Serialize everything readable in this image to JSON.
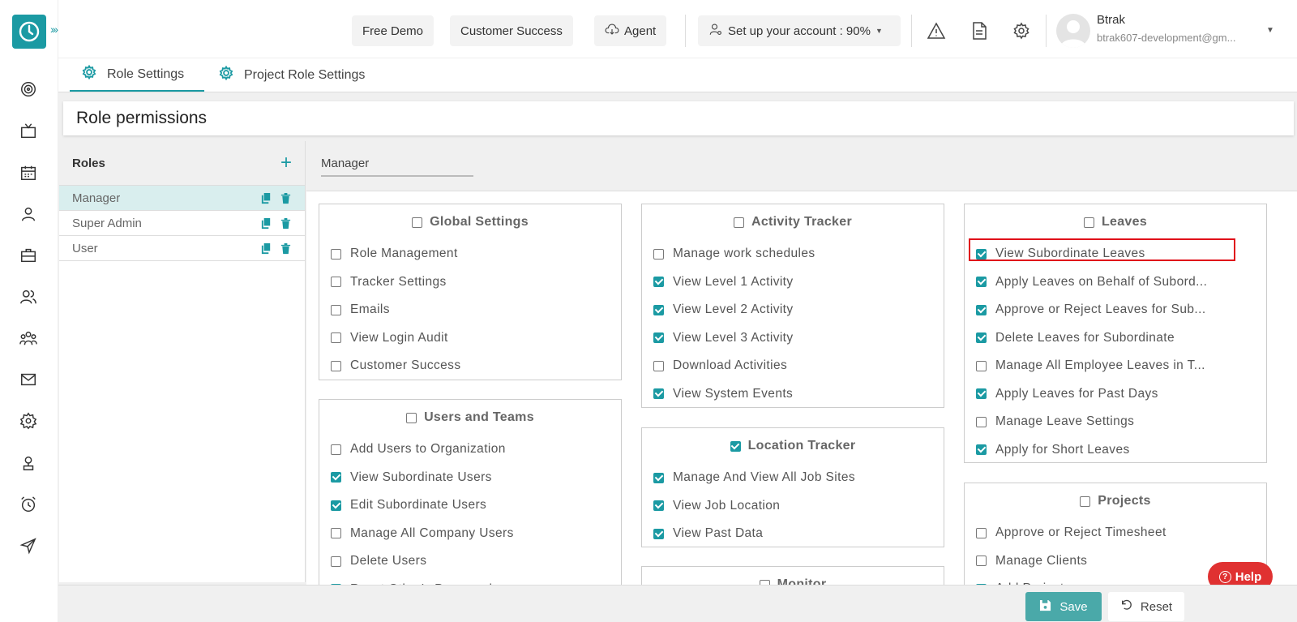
{
  "topbar": {
    "free_demo": "Free Demo",
    "customer_success": "Customer Success",
    "agent": "Agent",
    "setup_account": "Set up your account : 90%",
    "user_name": "Btrak",
    "user_email": "btrak607-development@gm..."
  },
  "tabs": [
    {
      "label": "Role Settings",
      "active": true
    },
    {
      "label": "Project Role Settings",
      "active": false
    }
  ],
  "page_title": "Role permissions",
  "roles": {
    "title": "Roles",
    "items": [
      {
        "name": "Manager",
        "selected": true
      },
      {
        "name": "Super Admin",
        "selected": false
      },
      {
        "name": "User",
        "selected": false
      }
    ]
  },
  "selected_role": "Manager",
  "permission_groups": {
    "global_settings": {
      "title": "Global Settings",
      "checked": false,
      "items": [
        {
          "label": "Role Management",
          "checked": false
        },
        {
          "label": "Tracker Settings",
          "checked": false
        },
        {
          "label": "Emails",
          "checked": false
        },
        {
          "label": "View Login Audit",
          "checked": false
        },
        {
          "label": "Customer Success",
          "checked": false
        }
      ]
    },
    "users_and_teams": {
      "title": "Users and Teams",
      "checked": false,
      "items": [
        {
          "label": "Add Users to Organization",
          "checked": false
        },
        {
          "label": "View Subordinate Users",
          "checked": true
        },
        {
          "label": "Edit Subordinate Users",
          "checked": true
        },
        {
          "label": "Manage All Company Users",
          "checked": false
        },
        {
          "label": "Delete Users",
          "checked": false
        },
        {
          "label": "Reset Other's Password",
          "checked": true
        }
      ]
    },
    "activity_tracker": {
      "title": "Activity Tracker",
      "checked": false,
      "items": [
        {
          "label": "Manage work schedules",
          "checked": false
        },
        {
          "label": "View Level 1 Activity",
          "checked": true
        },
        {
          "label": "View Level 2 Activity",
          "checked": true
        },
        {
          "label": "View Level 3 Activity",
          "checked": true
        },
        {
          "label": "Download Activities",
          "checked": false
        },
        {
          "label": "View System Events",
          "checked": true
        }
      ]
    },
    "location_tracker": {
      "title": "Location Tracker",
      "checked": true,
      "items": [
        {
          "label": "Manage And View All Job Sites",
          "checked": true
        },
        {
          "label": "View Job Location",
          "checked": true
        },
        {
          "label": "View Past Data",
          "checked": true
        }
      ]
    },
    "monitor": {
      "title": "Monitor",
      "checked": false,
      "items": []
    },
    "leaves": {
      "title": "Leaves",
      "checked": false,
      "items": [
        {
          "label": "View Subordinate Leaves",
          "checked": true
        },
        {
          "label": "Apply Leaves on Behalf of Subord...",
          "checked": true
        },
        {
          "label": "Approve or Reject Leaves for Sub...",
          "checked": true
        },
        {
          "label": "Delete Leaves for Subordinate",
          "checked": true
        },
        {
          "label": "Manage All Employee Leaves in T...",
          "checked": false
        },
        {
          "label": "Apply Leaves for Past Days",
          "checked": true
        },
        {
          "label": "Manage Leave Settings",
          "checked": false
        },
        {
          "label": "Apply for Short Leaves",
          "checked": true
        }
      ]
    },
    "projects": {
      "title": "Projects",
      "checked": false,
      "items": [
        {
          "label": "Approve or Reject Timesheet",
          "checked": false
        },
        {
          "label": "Manage Clients",
          "checked": false
        },
        {
          "label": "Add Projects",
          "checked": true
        }
      ]
    }
  },
  "help_label": "Help",
  "footer": {
    "save": "Save",
    "reset": "Reset"
  },
  "colors": {
    "accent": "#1b9aa3",
    "highlight": "#e0101a",
    "help": "#e03131"
  }
}
